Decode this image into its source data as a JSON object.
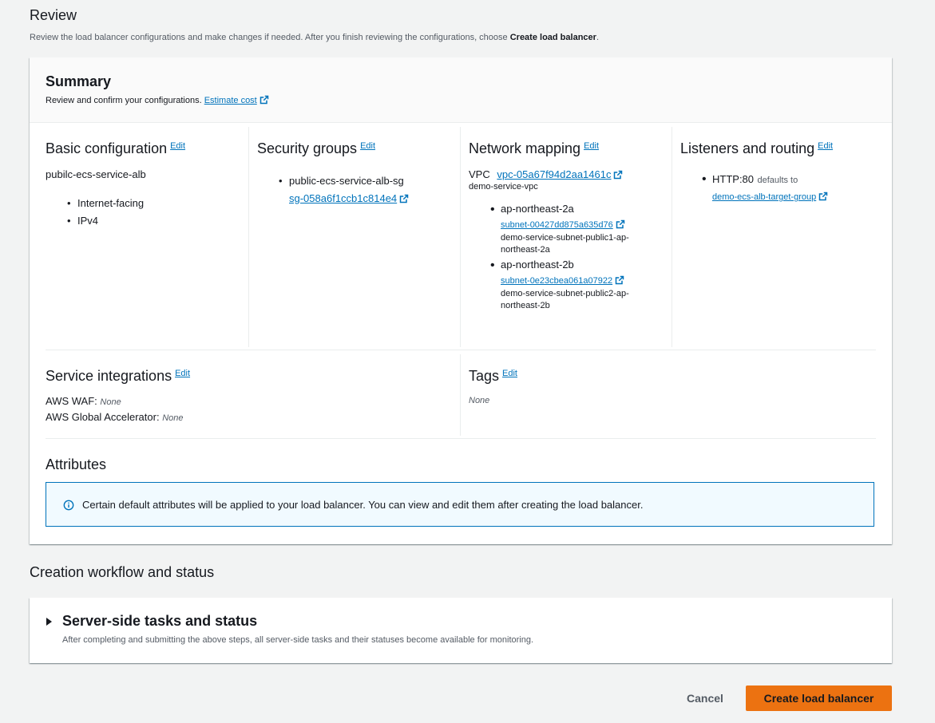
{
  "review": {
    "title": "Review",
    "description": "Review the load balancer configurations and make changes if needed. After you finish reviewing the configurations, choose",
    "description_bold": "Create load balancer",
    "description_end": "."
  },
  "summary": {
    "title": "Summary",
    "description": "Review and confirm your configurations.",
    "estimate_link": "Estimate cost",
    "edit_label": "Edit",
    "basic": {
      "title": "Basic configuration",
      "name": "pubilc-ecs-service-alb",
      "items": [
        "Internet-facing",
        "IPv4"
      ]
    },
    "security": {
      "title": "Security groups",
      "group_name": "public-ecs-service-alb-sg",
      "group_id": "sg-058a6f1ccb1c814e4"
    },
    "network": {
      "title": "Network mapping",
      "vpc_label": "VPC",
      "vpc_id": "vpc-05a67f94d2aa1461c",
      "vpc_name": "demo-service-vpc",
      "zones": [
        {
          "az": "ap-northeast-2a",
          "subnet_id": "subnet-00427dd875a635d76",
          "subnet_name": "demo-service-subnet-public1-ap-northeast-2a"
        },
        {
          "az": "ap-northeast-2b",
          "subnet_id": "subnet-0e23cbea061a07922",
          "subnet_name": "demo-service-subnet-public2-ap-northeast-2b"
        }
      ]
    },
    "listeners": {
      "title": "Listeners and routing",
      "listener": "HTTP:80",
      "defaults_to": "defaults to",
      "target_group": "demo-ecs-alb-target-group"
    },
    "service_integrations": {
      "title": "Service integrations",
      "waf_label": "AWS WAF:",
      "waf_value": "None",
      "ga_label": "AWS Global Accelerator:",
      "ga_value": "None"
    },
    "tags": {
      "title": "Tags",
      "value": "None"
    },
    "attributes": {
      "title": "Attributes",
      "info": "Certain default attributes will be applied to your load balancer. You can view and edit them after creating the load balancer."
    }
  },
  "workflow": {
    "title": "Creation workflow and status",
    "tasks_title": "Server-side tasks and status",
    "tasks_description": "After completing and submitting the above steps, all server-side tasks and their statuses become available for monitoring."
  },
  "actions": {
    "cancel": "Cancel",
    "create": "Create load balancer"
  },
  "colors": {
    "link": "#0073bb",
    "primary_button": "#ec7211",
    "info_bg": "#f1faff"
  }
}
